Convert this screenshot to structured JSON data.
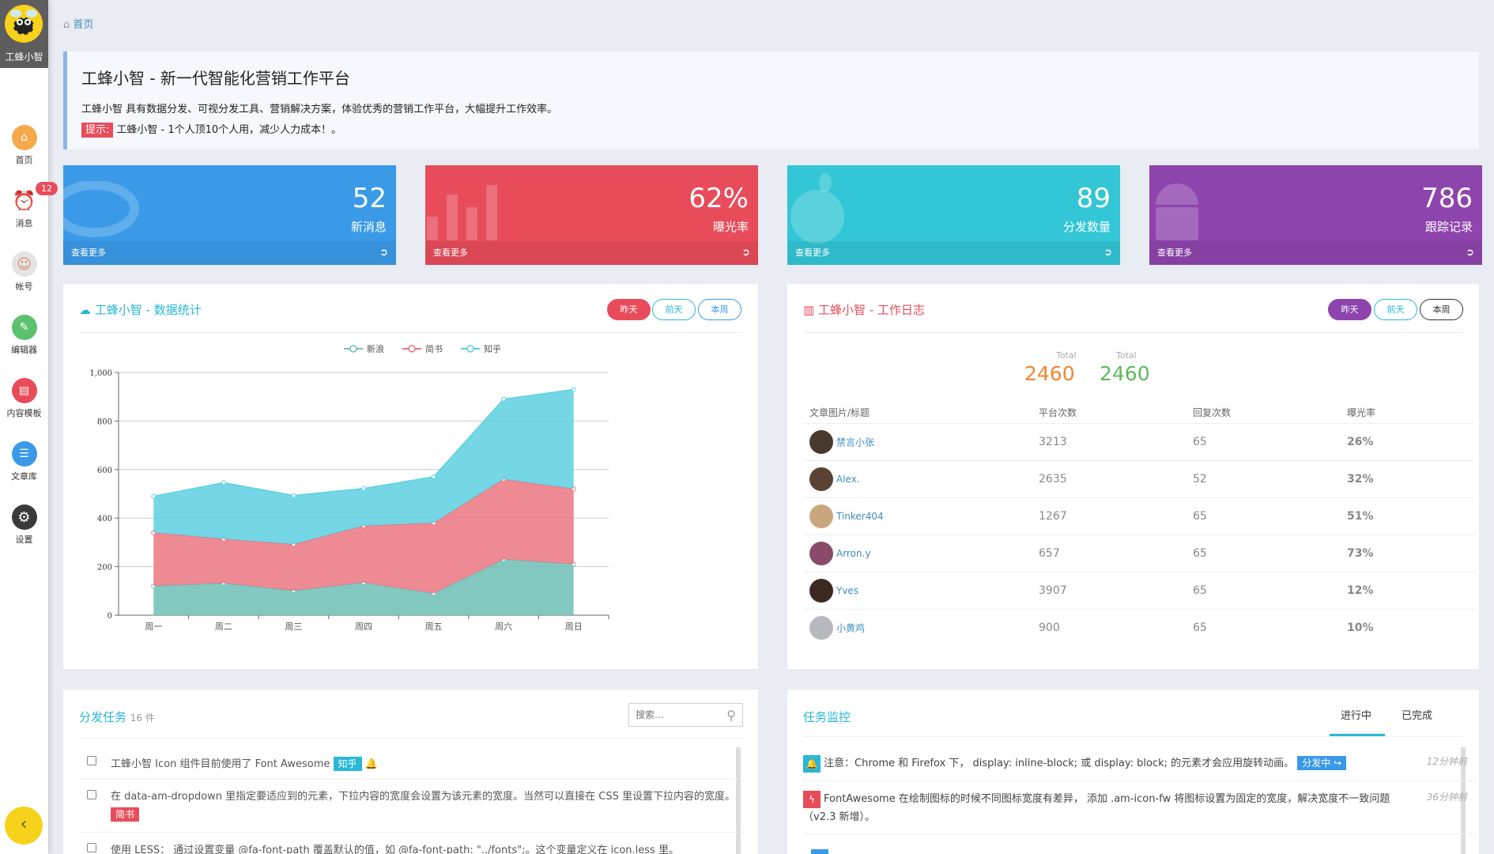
{
  "sidebar": {
    "logo_text": "工蜂小智",
    "items": [
      {
        "label": "首页",
        "icon": "home-icon",
        "color": "#f5a94b"
      },
      {
        "label": "消息",
        "icon": "alarm-icon",
        "color": "#e84c5b",
        "badge": "12"
      },
      {
        "label": "帐号",
        "icon": "avatar-icon",
        "color": "#e0c9a6"
      },
      {
        "label": "编辑器",
        "icon": "pencil-icon",
        "color": "#5cc16d"
      },
      {
        "label": "内容模板",
        "icon": "document-icon",
        "color": "#e84c5b"
      },
      {
        "label": "文章库",
        "icon": "article-icon",
        "color": "#3a9ae8"
      },
      {
        "label": "设置",
        "icon": "gear-icon",
        "color": "#3a3a3a"
      }
    ]
  },
  "breadcrumb": "首页",
  "intro": {
    "title": "工蜂小智 - 新一代智能化营销工作平台",
    "desc": "工蜂小智 具有数据分发、可视分发工具、营销解决方案，体验优秀的营销工作平台，大幅提升工作效率。",
    "tip_label": "提示:",
    "tip_text": "工蜂小智 - 1个人顶10个人用，减少人力成本！。"
  },
  "stat_cards": [
    {
      "value": "52",
      "label": "新消息",
      "more": "查看更多",
      "color": "#3a9ae8"
    },
    {
      "value": "62%",
      "label": "曝光率",
      "more": "查看更多",
      "color": "#e84c5b"
    },
    {
      "value": "89",
      "label": "分发数量",
      "more": "查看更多",
      "color": "#32c6d6"
    },
    {
      "value": "786",
      "label": "跟踪记录",
      "more": "查看更多",
      "color": "#8e44ad"
    }
  ],
  "stats_panel": {
    "title": "工蜂小智 - 数据统计",
    "buttons": [
      "昨天",
      "前天",
      "本周"
    ]
  },
  "chart_data": {
    "type": "area",
    "categories": [
      "周一",
      "周二",
      "周三",
      "周四",
      "周五",
      "周六",
      "周日"
    ],
    "series": [
      {
        "name": "新浪",
        "values": [
          120,
          132,
          101,
          134,
          90,
          230,
          210
        ],
        "color": "#6fc0b6"
      },
      {
        "name": "简书",
        "values": [
          220,
          182,
          191,
          234,
          290,
          330,
          310
        ],
        "color": "#eb7680"
      },
      {
        "name": "知乎",
        "values": [
          150,
          232,
          201,
          154,
          190,
          330,
          410
        ],
        "color": "#5dd0e0"
      }
    ],
    "stacked": true,
    "ylim": [
      0,
      1000
    ],
    "yticks": [
      "0",
      "200",
      "400",
      "600",
      "800",
      "1,000"
    ],
    "legend": "top-center",
    "grid": true
  },
  "log_panel": {
    "title": "工蜂小智 - 工作日志",
    "buttons": [
      "昨天",
      "前天",
      "本周"
    ],
    "totals": [
      {
        "label": "Total",
        "value": "2460",
        "color": "#f0852f"
      },
      {
        "label": "Total",
        "value": "2460",
        "color": "#5cb85c"
      }
    ],
    "headers": [
      "文章图片/标题",
      "平台次数",
      "回复次数",
      "曝光率"
    ],
    "rows": [
      {
        "name": "禁言小张",
        "platform": "3213",
        "replies": "65",
        "rate": "26%"
      },
      {
        "name": "Alex.",
        "platform": "2635",
        "replies": "52",
        "rate": "32%"
      },
      {
        "name": "Tinker404",
        "platform": "1267",
        "replies": "65",
        "rate": "51%"
      },
      {
        "name": "Arron.y",
        "platform": "657",
        "replies": "65",
        "rate": "73%"
      },
      {
        "name": "Yves",
        "platform": "3907",
        "replies": "65",
        "rate": "12%"
      },
      {
        "name": "小黄鸡",
        "platform": "900",
        "replies": "65",
        "rate": "10%"
      }
    ]
  },
  "tasks_panel": {
    "title": "分发任务",
    "count": "16 件",
    "search_placeholder": "搜索...",
    "items": [
      {
        "text": "工蜂小智 Icon 组件目前使用了 Font Awesome",
        "tag": "知乎",
        "tag_color": "#28b7d6"
      },
      {
        "text": "在 data-am-dropdown 里指定要适应到的元素，下拉内容的宽度会设置为该元素的宽度。当然可以直接在 CSS 里设置下拉内容的宽度。",
        "tag": "简书",
        "tag_color": "#e84c5b"
      },
      {
        "text": "使用 LESS： 通过设置变量 @fa-font-path 覆盖默认的值，如 @fa-font-path: \"../fonts\";。这个变量定义在 icon.less 里。",
        "tag": "",
        "tag_color": ""
      }
    ]
  },
  "monitor_panel": {
    "title": "任务监控",
    "tabs": [
      "进行中",
      "已完成"
    ],
    "items": [
      {
        "text": "注意：Chrome 和 Firefox 下， display: inline-block; 或 display: block; 的元素才会应用旋转动画。",
        "badge": "分发中",
        "time": "12分钟前",
        "icon_color": "#28b7d6"
      },
      {
        "text": "FontAwesome 在绘制图标的时候不同图标宽度有差异， 添加 .am-icon-fw 将图标设置为固定的宽度，解决宽度不一致问题（v2.3 新增）。",
        "badge": "",
        "time": "36分钟前",
        "icon_color": "#e84c5b"
      }
    ]
  }
}
